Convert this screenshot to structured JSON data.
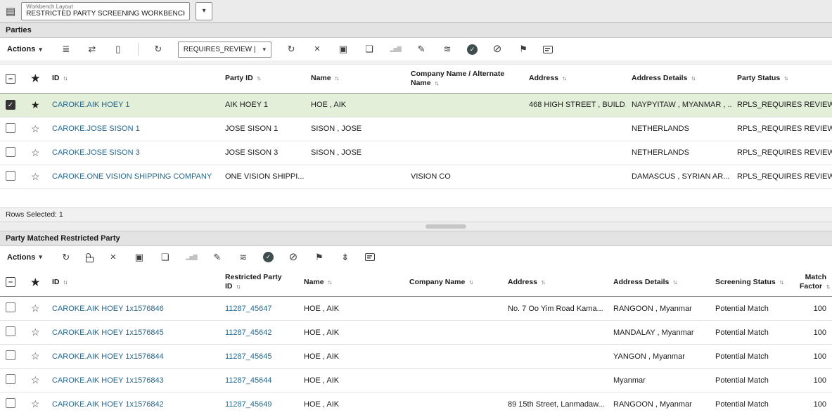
{
  "topbar": {
    "layout_label": "Workbench Layout",
    "layout_value": "RESTRICTED PARTY SCREENING WORKBENCH |"
  },
  "icons": {
    "menu": "▤",
    "caret": "▾",
    "settings": "≣",
    "swap": "⇄",
    "document": "▯",
    "refresh": "↻",
    "cancel": "✕",
    "save": "▣",
    "copy": "❏",
    "chart": "▂▅▇",
    "edit": "✎",
    "sliders": "≋",
    "check": "✓",
    "block": "⊘",
    "flag": "⚑",
    "collapse": "⇟",
    "star_filled": "★",
    "star_outline": "☆",
    "sort": "↑↓",
    "minus": "–"
  },
  "parties": {
    "title": "Parties",
    "actions_label": "Actions",
    "status_filter": "REQUIRES_REVIEW |",
    "columns": [
      "ID",
      "Party ID",
      "Name",
      "Company Name / Alternate Name",
      "Address",
      "Address Details",
      "Party Status"
    ],
    "rows": [
      {
        "id": "CAROKE.AIK HOEY 1",
        "party_id": "AIK HOEY 1",
        "name": "HOE , AIK",
        "company": "",
        "address": "468 HIGH STREET , BUILD...",
        "address_details": "NAYPYITAW , MYANMAR , ...",
        "status": "RPLS_REQUIRES REVIEW"
      },
      {
        "id": "CAROKE.JOSE SISON 1",
        "party_id": "JOSE SISON 1",
        "name": "SISON , JOSE",
        "company": "",
        "address": "",
        "address_details": "NETHERLANDS",
        "status": "RPLS_REQUIRES REVIEW"
      },
      {
        "id": "CAROKE.JOSE SISON 3",
        "party_id": "JOSE SISON 3",
        "name": "SISON , JOSE",
        "company": "",
        "address": "",
        "address_details": "NETHERLANDS",
        "status": "RPLS_REQUIRES REVIEW"
      },
      {
        "id": "CAROKE.ONE VISION SHIPPING COMPANY",
        "party_id": "ONE VISION SHIPPI...",
        "name": "",
        "company": "VISION CO",
        "address": "",
        "address_details": "DAMASCUS , SYRIAN AR...",
        "status": "RPLS_REQUIRES REVIEW"
      }
    ],
    "rows_selected": "Rows Selected: 1"
  },
  "matches": {
    "title": "Party Matched Restricted Party",
    "actions_label": "Actions",
    "columns": [
      "ID",
      "Restricted Party ID",
      "Name",
      "Company Name",
      "Address",
      "Address Details",
      "Screening Status",
      "Match Factor"
    ],
    "rows": [
      {
        "id": "CAROKE.AIK HOEY 1x1576846",
        "restricted_party_id": "11287_45647",
        "name": "HOE , AIK",
        "company": "",
        "address": "No. 7 Oo Yim Road Kama...",
        "address_details": "RANGOON , Myanmar",
        "screening_status": "Potential Match",
        "match_factor": "100"
      },
      {
        "id": "CAROKE.AIK HOEY 1x1576845",
        "restricted_party_id": "11287_45642",
        "name": "HOE , AIK",
        "company": "",
        "address": "",
        "address_details": "MANDALAY , Myanmar",
        "screening_status": "Potential Match",
        "match_factor": "100"
      },
      {
        "id": "CAROKE.AIK HOEY 1x1576844",
        "restricted_party_id": "11287_45645",
        "name": "HOE , AIK",
        "company": "",
        "address": "",
        "address_details": "YANGON , Myanmar",
        "screening_status": "Potential Match",
        "match_factor": "100"
      },
      {
        "id": "CAROKE.AIK HOEY 1x1576843",
        "restricted_party_id": "11287_45644",
        "name": "HOE , AIK",
        "company": "",
        "address": "",
        "address_details": "Myanmar",
        "screening_status": "Potential Match",
        "match_factor": "100"
      },
      {
        "id": "CAROKE.AIK HOEY 1x1576842",
        "restricted_party_id": "11287_45649",
        "name": "HOE , AIK",
        "company": "",
        "address": "89 15th Street, Lanmadaw...",
        "address_details": "RANGOON , Myanmar",
        "screening_status": "Potential Match",
        "match_factor": "100"
      }
    ]
  },
  "colors": {
    "link": "#24678D",
    "selected_row": "#E4EFDA",
    "accent_circle": "#3E4D4D"
  }
}
